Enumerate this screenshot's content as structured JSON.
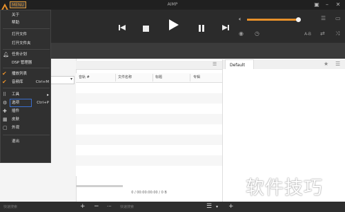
{
  "app": {
    "title": "AIMP",
    "menu_label": "MENU"
  },
  "player": {
    "controls": [
      "prev",
      "stop",
      "play",
      "pause",
      "next"
    ],
    "volume_percent": 96,
    "ab_label": "A-B"
  },
  "menu": {
    "items": [
      {
        "label": "关于"
      },
      {
        "label": "帮助"
      },
      {
        "label": "打开文件"
      },
      {
        "label": "打开文件夹"
      },
      {
        "label": "任务计划"
      },
      {
        "label": "DSP 管理器"
      },
      {
        "label": "播放列表",
        "checked": true
      },
      {
        "label": "音频库",
        "checked": true,
        "shortcut": "Ctrl+M"
      },
      {
        "label": "工具",
        "submenu": true
      },
      {
        "label": "选项",
        "shortcut": "Ctrl+P",
        "highlighted": true
      },
      {
        "label": "插件"
      },
      {
        "label": "皮肤"
      },
      {
        "label": "外观"
      },
      {
        "label": "退出"
      }
    ]
  },
  "playlist": {
    "columns": [
      "音轨 #",
      "文件名称",
      "标题",
      "专辑"
    ],
    "status": "0 / 00:00:00:00 / 0 B"
  },
  "right_panel": {
    "tab": "Default"
  },
  "bottom_bar": {
    "search_placeholder_left": "快速搜索",
    "search_placeholder_right": "快速搜索",
    "add_label": "+",
    "remove_label": "−",
    "more_label": "···"
  },
  "watermark": "软件技巧",
  "colors": {
    "accent": "#e8902a",
    "menu_bg": "#303030",
    "player_bg": "#2b2b2b"
  }
}
